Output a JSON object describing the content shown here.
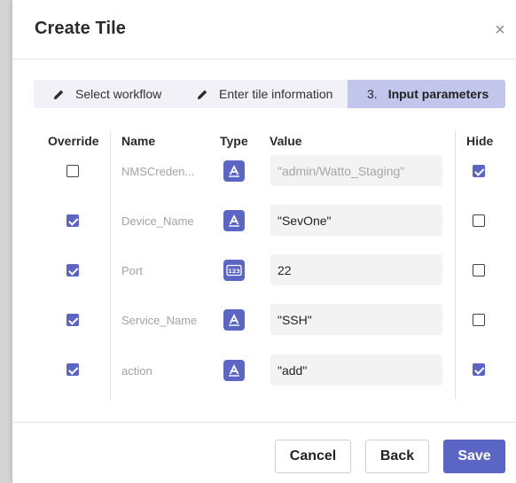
{
  "dialog": {
    "title": "Create Tile",
    "close_glyph": "×"
  },
  "stepper": {
    "steps": [
      {
        "label": "Select workflow",
        "icon": "pencil-icon"
      },
      {
        "label": "Enter tile information",
        "icon": "pencil-icon"
      },
      {
        "number": "3.",
        "label": "Input parameters",
        "active": true
      }
    ]
  },
  "table": {
    "headers": {
      "override": "Override",
      "name": "Name",
      "type": "Type",
      "value": "Value",
      "hide": "Hide"
    },
    "rows": [
      {
        "override": false,
        "name": "NMSCreden...",
        "type": "text-type-icon",
        "value": "\"admin/Watto_Staging\"",
        "value_disabled": true,
        "hide": true
      },
      {
        "override": true,
        "name": "Device_Name",
        "type": "text-type-icon",
        "value": "\"SevOne\"",
        "value_disabled": false,
        "hide": false
      },
      {
        "override": true,
        "name": "Port",
        "type": "number-type-icon",
        "value": "22",
        "value_disabled": false,
        "hide": false
      },
      {
        "override": true,
        "name": "Service_Name",
        "type": "text-type-icon",
        "value": "\"SSH\"",
        "value_disabled": false,
        "hide": false
      },
      {
        "override": true,
        "name": "action",
        "type": "text-type-icon",
        "value": "\"add\"",
        "value_disabled": false,
        "hide": true
      }
    ]
  },
  "footer": {
    "cancel_label": "Cancel",
    "back_label": "Back",
    "save_label": "Save"
  },
  "colors": {
    "accent": "#5b66c4",
    "active_step": "#c3c6ec",
    "stepper_bg": "#f1f1f7",
    "input_bg": "#f3f3f3"
  }
}
